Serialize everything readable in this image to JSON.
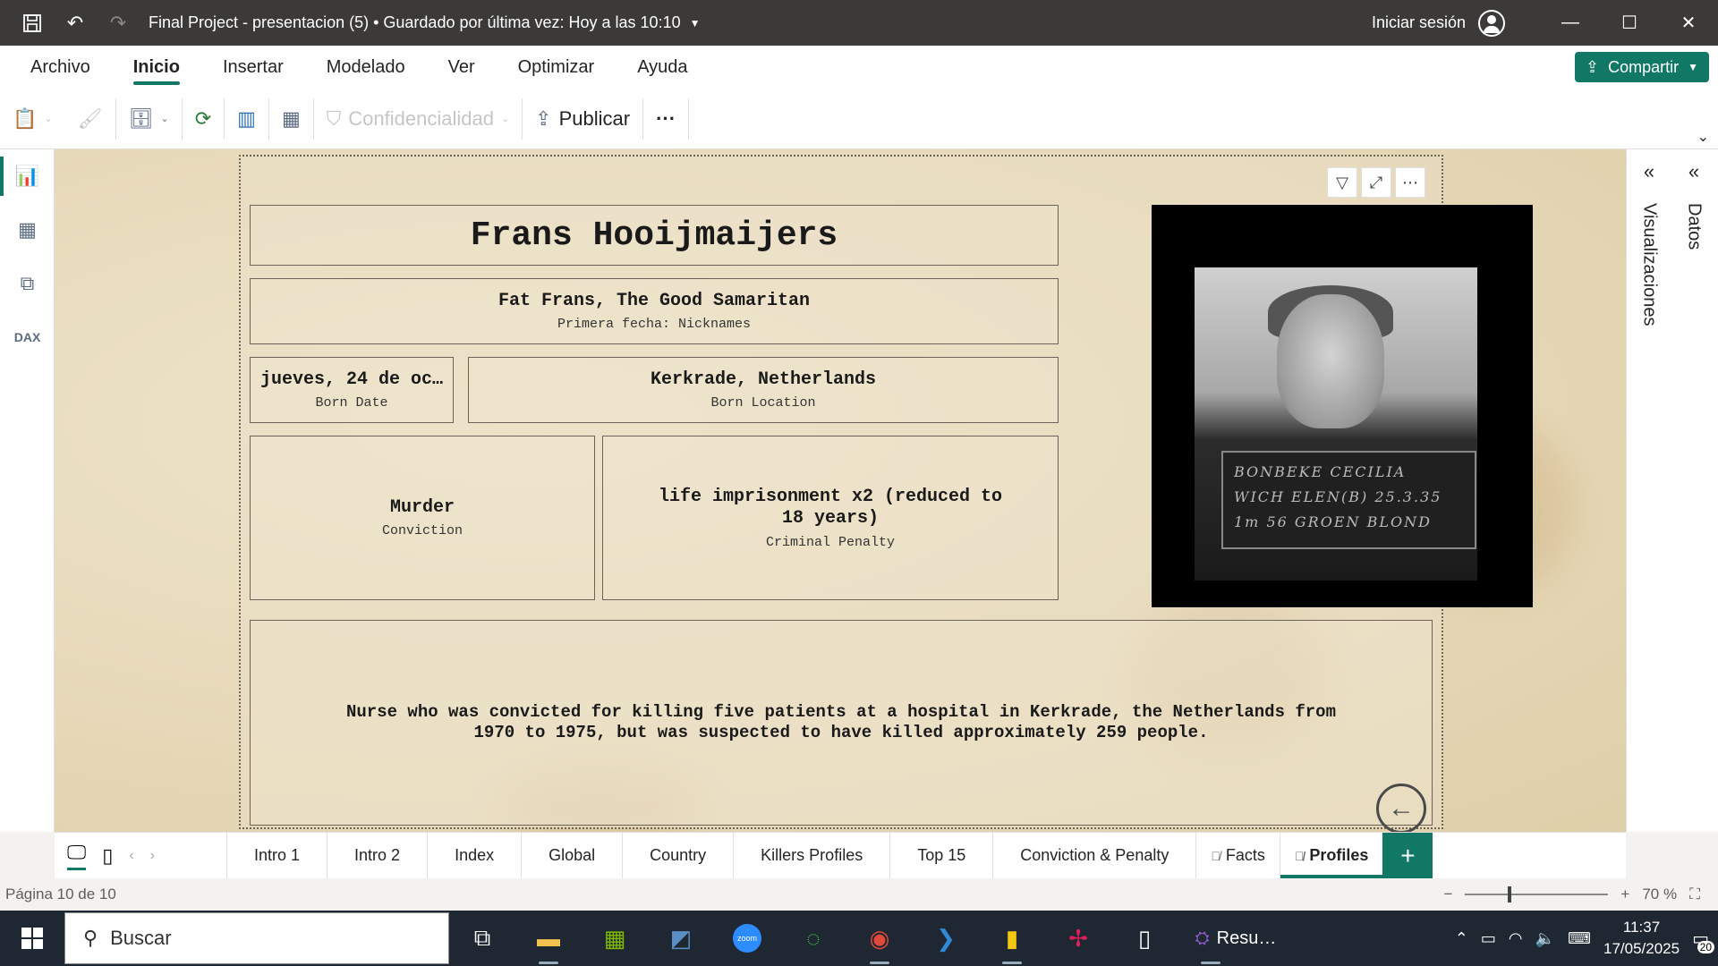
{
  "window": {
    "title": "Final Project - presentacion (5) • Guardado por última vez: Hoy a las 10:10",
    "signin": "Iniciar sesión"
  },
  "menu": {
    "items": [
      "Archivo",
      "Inicio",
      "Insertar",
      "Modelado",
      "Ver",
      "Optimizar",
      "Ayuda"
    ],
    "active": "Inicio",
    "share_label": "Compartir"
  },
  "ribbon": {
    "confidencialidad_label": "Confidencialidad",
    "publicar_label": "Publicar",
    "more_label": "···"
  },
  "report": {
    "name": "Frans Hooijmaijers",
    "nicknames_value": "Fat Frans, The Good Samaritan",
    "nicknames_label": "Primera fecha: Nicknames",
    "born_date_value": "jueves, 24 de oc…",
    "born_date_label": "Born Date",
    "born_location_value": "Kerkrade, Netherlands",
    "born_location_label": "Born Location",
    "conviction_value": "Murder",
    "conviction_label": "Conviction",
    "penalty_value": "life imprisonment x2 (reduced to 18 years)",
    "penalty_label": "Criminal Penalty",
    "description": "Nurse who was convicted for killing five patients at a hospital in Kerkrade, the Netherlands from 1970 to 1975, but was suspected to have killed approximately 259 people.",
    "photo_board_lines": [
      "BONBEKE CECILIA",
      "WICH ELEN(B) 25.3.35",
      "1m 56 GROEN BLOND"
    ]
  },
  "panes": {
    "visualizations": "Visualizaciones",
    "data": "Datos"
  },
  "tabs": [
    {
      "label": "Intro 1",
      "active": false,
      "hidden": false
    },
    {
      "label": "Intro 2",
      "active": false,
      "hidden": false
    },
    {
      "label": "Index",
      "active": false,
      "hidden": false
    },
    {
      "label": "Global",
      "active": false,
      "hidden": false
    },
    {
      "label": "Country",
      "active": false,
      "hidden": false
    },
    {
      "label": "Killers Profiles",
      "active": false,
      "hidden": false
    },
    {
      "label": "Top 15",
      "active": false,
      "hidden": false
    },
    {
      "label": "Conviction & Penalty",
      "active": false,
      "hidden": false
    },
    {
      "label": "Facts",
      "active": false,
      "hidden": true
    },
    {
      "label": "Profiles",
      "active": true,
      "hidden": true
    }
  ],
  "status": {
    "page": "Página 10 de 10",
    "zoom": "70 %"
  },
  "taskbar": {
    "search_placeholder": "Buscar",
    "running_app": "Resu…",
    "time": "11:37",
    "date": "17/05/2025",
    "notifications": "20"
  }
}
